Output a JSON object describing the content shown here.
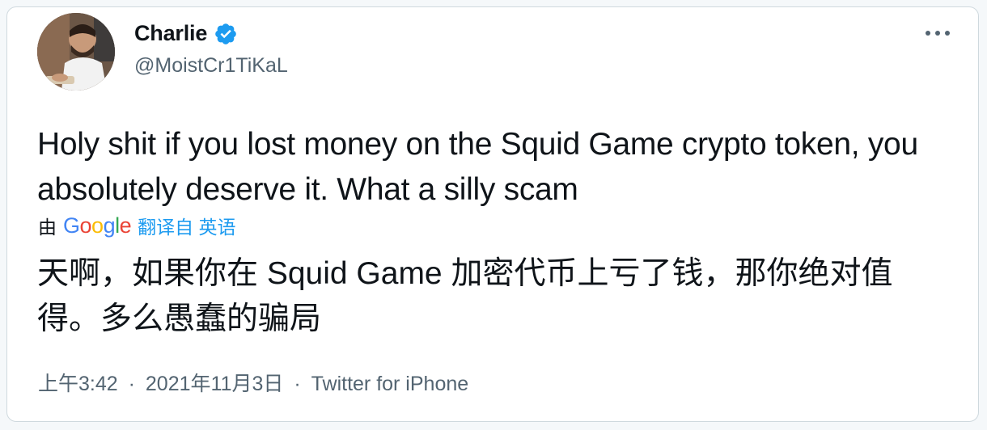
{
  "user": {
    "display_name": "Charlie",
    "handle": "@MoistCr1TiKaL",
    "verified": true
  },
  "tweet": {
    "text": "Holy shit if you lost money on the Squid Game crypto token, you absolutely deserve it. What a silly scam"
  },
  "translation": {
    "prefix": "由",
    "provider_letters": [
      "G",
      "o",
      "o",
      "g",
      "l",
      "e"
    ],
    "link_text": "翻译自 英语",
    "text": "天啊，如果你在 Squid Game 加密代币上亏了钱，那你绝对值得。多么愚蠢的骗局"
  },
  "meta": {
    "time": "上午3:42",
    "date": "2021年11月3日",
    "source": "Twitter for iPhone",
    "separator": "·"
  },
  "colors": {
    "verified": "#1d9bf0",
    "link": "#1d9bf0",
    "muted": "#536471",
    "text": "#0f1419"
  },
  "icons": {
    "verified": "verified-badge-icon",
    "more": "more-options-icon"
  }
}
